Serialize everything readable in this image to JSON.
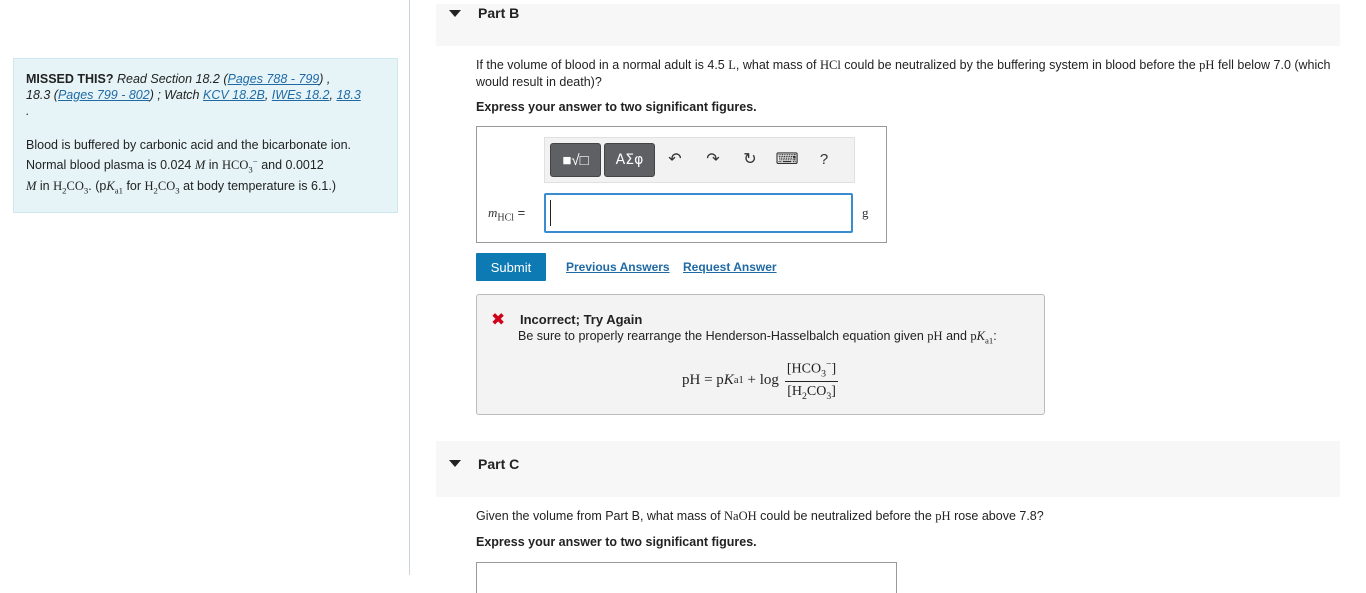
{
  "missed": {
    "lead": "MISSED THIS?",
    "read_prefix": "Read Section 18.2 (",
    "pages1": "Pages 788 - 799",
    "mid1": ") ,",
    "section2": "18.3 (",
    "pages2": "Pages 799 - 802",
    "watch": ") ; Watch",
    "kcv": "KCV 18.2B",
    "comma1": ",",
    "iwes": "IWEs 18.2",
    "comma2": ",",
    "iwe3": "18.3",
    "period": ".",
    "p1": "Blood is buffered by carbonic acid and the bicarbonate ion. Normal blood plasma is 0.024",
    "unit_m": "M",
    "in1": "in",
    "hco3": "HCO",
    "and": "and 0.0012",
    "in2": "in",
    "h2co3": "H",
    "pka_open": ". (p",
    "pka_k": "K",
    "pka_sub": "a1",
    "for": "for",
    "tail": "at body temperature is 6.1.)"
  },
  "part_b": {
    "title": "Part B",
    "question_pre": "If the volume of blood in a normal adult is 4.5",
    "q_unit": "L",
    "q_mid": ", what mass of",
    "q_hcl": "HCl",
    "q_mid2": "could be neutralized by the buffering system in blood before the",
    "q_ph": "pH",
    "q_end": "fell below 7.0 (which would result in death)?",
    "instruction": "Express your answer to two significant figures.",
    "answer_label": "m",
    "answer_sub": "HCl",
    "answer_eq": " =",
    "answer_unit": "g",
    "submit": "Submit",
    "previous_answers": "Previous Answers",
    "request_answer": "Request Answer"
  },
  "toolbar": {
    "templates_icon": "■√□",
    "greek": "ΑΣφ",
    "undo_icon": "↶",
    "redo_icon": "↷",
    "reset_icon": "↻",
    "keyboard_icon": "⌨",
    "help": "?"
  },
  "feedback": {
    "icon": "✖",
    "title": "Incorrect; Try Again",
    "text_pre": "Be sure to properly rearrange the Henderson-Hasselbalch equation given",
    "text_ph": "pH",
    "text_and": "and",
    "text_pka": "pK",
    "text_pka_sub": "a1",
    "text_colon": ":",
    "eq_lhs": "pH = p",
    "eq_k": "K",
    "eq_sub": "a1",
    "eq_plus": "+ log",
    "eq_num": "[HCO",
    "eq_den": "[H"
  },
  "part_c": {
    "title": "Part C",
    "question_pre": "Given the volume from Part B, what mass of",
    "q_naoh": "NaOH",
    "q_mid": "could be neutralized before the",
    "q_ph": "pH",
    "q_end": "rose above 7.8?",
    "instruction": "Express your answer to two significant figures."
  }
}
